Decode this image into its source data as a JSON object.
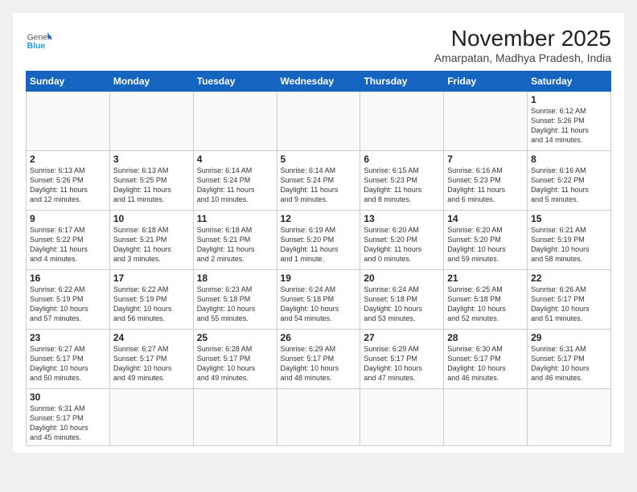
{
  "header": {
    "month_title": "November 2025",
    "location": "Amarpatan, Madhya Pradesh, India",
    "logo_general": "General",
    "logo_blue": "Blue"
  },
  "weekdays": [
    "Sunday",
    "Monday",
    "Tuesday",
    "Wednesday",
    "Thursday",
    "Friday",
    "Saturday"
  ],
  "weeks": [
    [
      {
        "day": null,
        "info": null
      },
      {
        "day": null,
        "info": null
      },
      {
        "day": null,
        "info": null
      },
      {
        "day": null,
        "info": null
      },
      {
        "day": null,
        "info": null
      },
      {
        "day": null,
        "info": null
      },
      {
        "day": "1",
        "info": "Sunrise: 6:12 AM\nSunset: 5:26 PM\nDaylight: 11 hours\nand 14 minutes."
      }
    ],
    [
      {
        "day": "2",
        "info": "Sunrise: 6:13 AM\nSunset: 5:26 PM\nDaylight: 11 hours\nand 12 minutes."
      },
      {
        "day": "3",
        "info": "Sunrise: 6:13 AM\nSunset: 5:25 PM\nDaylight: 11 hours\nand 11 minutes."
      },
      {
        "day": "4",
        "info": "Sunrise: 6:14 AM\nSunset: 5:24 PM\nDaylight: 11 hours\nand 10 minutes."
      },
      {
        "day": "5",
        "info": "Sunrise: 6:14 AM\nSunset: 5:24 PM\nDaylight: 11 hours\nand 9 minutes."
      },
      {
        "day": "6",
        "info": "Sunrise: 6:15 AM\nSunset: 5:23 PM\nDaylight: 11 hours\nand 8 minutes."
      },
      {
        "day": "7",
        "info": "Sunrise: 6:16 AM\nSunset: 5:23 PM\nDaylight: 11 hours\nand 6 minutes."
      },
      {
        "day": "8",
        "info": "Sunrise: 6:16 AM\nSunset: 5:22 PM\nDaylight: 11 hours\nand 5 minutes."
      }
    ],
    [
      {
        "day": "9",
        "info": "Sunrise: 6:17 AM\nSunset: 5:22 PM\nDaylight: 11 hours\nand 4 minutes."
      },
      {
        "day": "10",
        "info": "Sunrise: 6:18 AM\nSunset: 5:21 PM\nDaylight: 11 hours\nand 3 minutes."
      },
      {
        "day": "11",
        "info": "Sunrise: 6:18 AM\nSunset: 5:21 PM\nDaylight: 11 hours\nand 2 minutes."
      },
      {
        "day": "12",
        "info": "Sunrise: 6:19 AM\nSunset: 5:20 PM\nDaylight: 11 hours\nand 1 minute."
      },
      {
        "day": "13",
        "info": "Sunrise: 6:20 AM\nSunset: 5:20 PM\nDaylight: 11 hours\nand 0 minutes."
      },
      {
        "day": "14",
        "info": "Sunrise: 6:20 AM\nSunset: 5:20 PM\nDaylight: 10 hours\nand 59 minutes."
      },
      {
        "day": "15",
        "info": "Sunrise: 6:21 AM\nSunset: 5:19 PM\nDaylight: 10 hours\nand 58 minutes."
      }
    ],
    [
      {
        "day": "16",
        "info": "Sunrise: 6:22 AM\nSunset: 5:19 PM\nDaylight: 10 hours\nand 57 minutes."
      },
      {
        "day": "17",
        "info": "Sunrise: 6:22 AM\nSunset: 5:19 PM\nDaylight: 10 hours\nand 56 minutes."
      },
      {
        "day": "18",
        "info": "Sunrise: 6:23 AM\nSunset: 5:18 PM\nDaylight: 10 hours\nand 55 minutes."
      },
      {
        "day": "19",
        "info": "Sunrise: 6:24 AM\nSunset: 5:18 PM\nDaylight: 10 hours\nand 54 minutes."
      },
      {
        "day": "20",
        "info": "Sunrise: 6:24 AM\nSunset: 5:18 PM\nDaylight: 10 hours\nand 53 minutes."
      },
      {
        "day": "21",
        "info": "Sunrise: 6:25 AM\nSunset: 5:18 PM\nDaylight: 10 hours\nand 52 minutes."
      },
      {
        "day": "22",
        "info": "Sunrise: 6:26 AM\nSunset: 5:17 PM\nDaylight: 10 hours\nand 51 minutes."
      }
    ],
    [
      {
        "day": "23",
        "info": "Sunrise: 6:27 AM\nSunset: 5:17 PM\nDaylight: 10 hours\nand 50 minutes."
      },
      {
        "day": "24",
        "info": "Sunrise: 6:27 AM\nSunset: 5:17 PM\nDaylight: 10 hours\nand 49 minutes."
      },
      {
        "day": "25",
        "info": "Sunrise: 6:28 AM\nSunset: 5:17 PM\nDaylight: 10 hours\nand 49 minutes."
      },
      {
        "day": "26",
        "info": "Sunrise: 6:29 AM\nSunset: 5:17 PM\nDaylight: 10 hours\nand 48 minutes."
      },
      {
        "day": "27",
        "info": "Sunrise: 6:29 AM\nSunset: 5:17 PM\nDaylight: 10 hours\nand 47 minutes."
      },
      {
        "day": "28",
        "info": "Sunrise: 6:30 AM\nSunset: 5:17 PM\nDaylight: 10 hours\nand 46 minutes."
      },
      {
        "day": "29",
        "info": "Sunrise: 6:31 AM\nSunset: 5:17 PM\nDaylight: 10 hours\nand 46 minutes."
      }
    ],
    [
      {
        "day": "30",
        "info": "Sunrise: 6:31 AM\nSunset: 5:17 PM\nDaylight: 10 hours\nand 45 minutes."
      },
      {
        "day": null,
        "info": null
      },
      {
        "day": null,
        "info": null
      },
      {
        "day": null,
        "info": null
      },
      {
        "day": null,
        "info": null
      },
      {
        "day": null,
        "info": null
      },
      {
        "day": null,
        "info": null
      }
    ]
  ]
}
